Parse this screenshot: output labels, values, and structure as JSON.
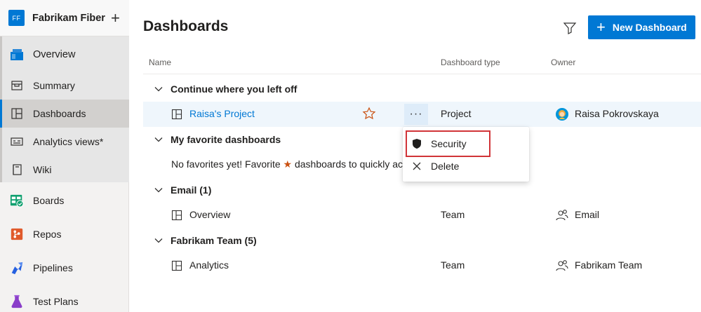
{
  "org": {
    "badge": "FF",
    "name": "Fabrikam Fiber",
    "plus": "+"
  },
  "nav": {
    "overview": "Overview",
    "summary": "Summary",
    "dashboards": "Dashboards",
    "analytics_views": "Analytics views*",
    "wiki": "Wiki",
    "boards": "Boards",
    "repos": "Repos",
    "pipelines": "Pipelines",
    "test_plans": "Test Plans"
  },
  "page": {
    "title": "Dashboards",
    "new_dashboard_label": "New Dashboard",
    "new_dashboard_plus": "+"
  },
  "columns": {
    "name": "Name",
    "type": "Dashboard type",
    "owner": "Owner"
  },
  "groups": {
    "continue": "Continue where you left off",
    "favorites": "My favorite dashboards",
    "email": "Email (1)",
    "fabrikam": "Fabrikam Team (5)"
  },
  "rows": {
    "raisa": {
      "name": "Raisa's Project",
      "type": "Project",
      "owner": "Raisa Pokrovskaya",
      "more": "···"
    },
    "overview": {
      "name": "Overview",
      "type": "Team",
      "owner": "Email"
    },
    "analytics": {
      "name": "Analytics",
      "type": "Team",
      "owner": "Fabrikam Team"
    }
  },
  "favorites_empty": {
    "prefix": "No favorites yet! Favorite",
    "star": "★",
    "suffix": "dashboards to quickly ac"
  },
  "context_menu": {
    "security": "Security",
    "delete": "Delete"
  },
  "colors": {
    "accent": "#0078d4",
    "star": "#ca5010",
    "highlight": "#d13438"
  }
}
